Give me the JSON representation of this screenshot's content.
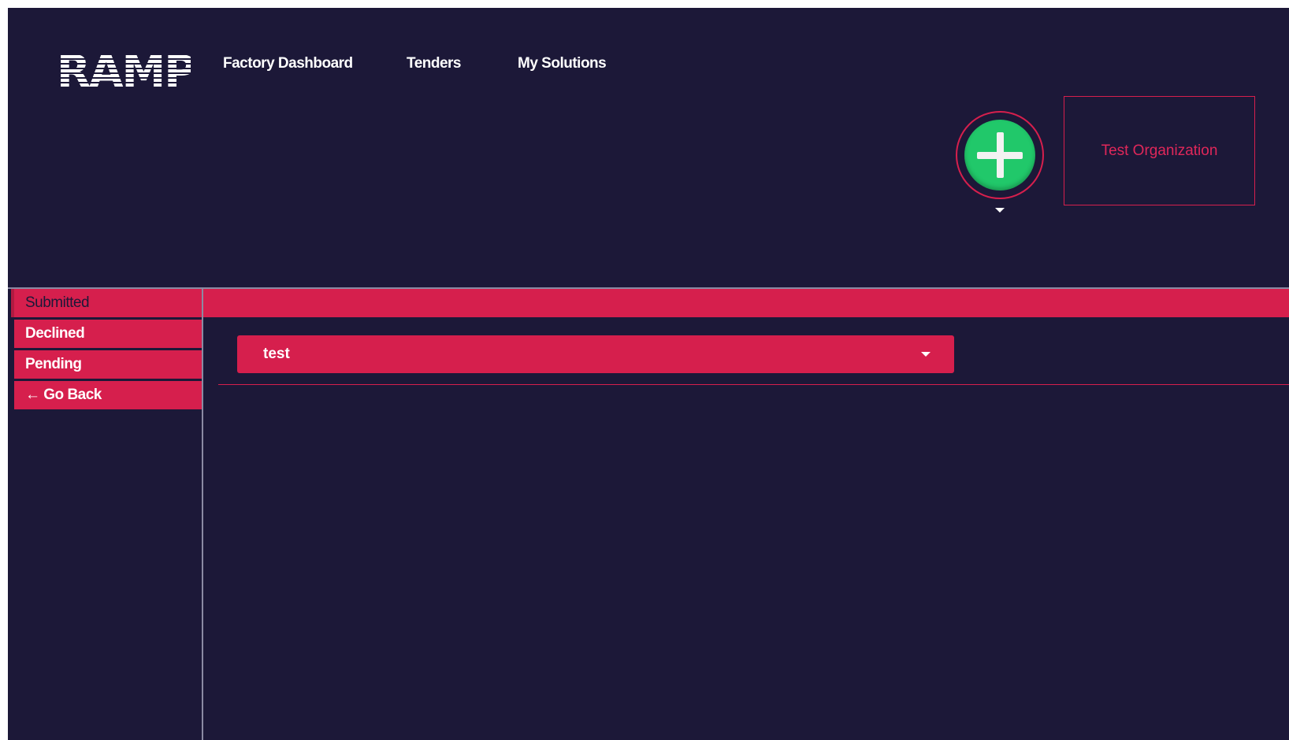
{
  "header": {
    "logo_text": "RAMP",
    "nav": [
      {
        "label": "Factory Dashboard"
      },
      {
        "label": "Tenders"
      },
      {
        "label": "My Solutions"
      }
    ],
    "add_button_icon": "plus-icon",
    "organization": "Test Organization"
  },
  "sidebar": {
    "items": [
      {
        "label": "Submitted",
        "active": true
      },
      {
        "label": "Declined"
      },
      {
        "label": "Pending"
      },
      {
        "label": "← Go Back"
      }
    ]
  },
  "main": {
    "select_value": "test"
  },
  "colors": {
    "background": "#1c1838",
    "accent": "#d61f4d",
    "add_button": "#21c86a",
    "divider": "#8b8aa3"
  }
}
